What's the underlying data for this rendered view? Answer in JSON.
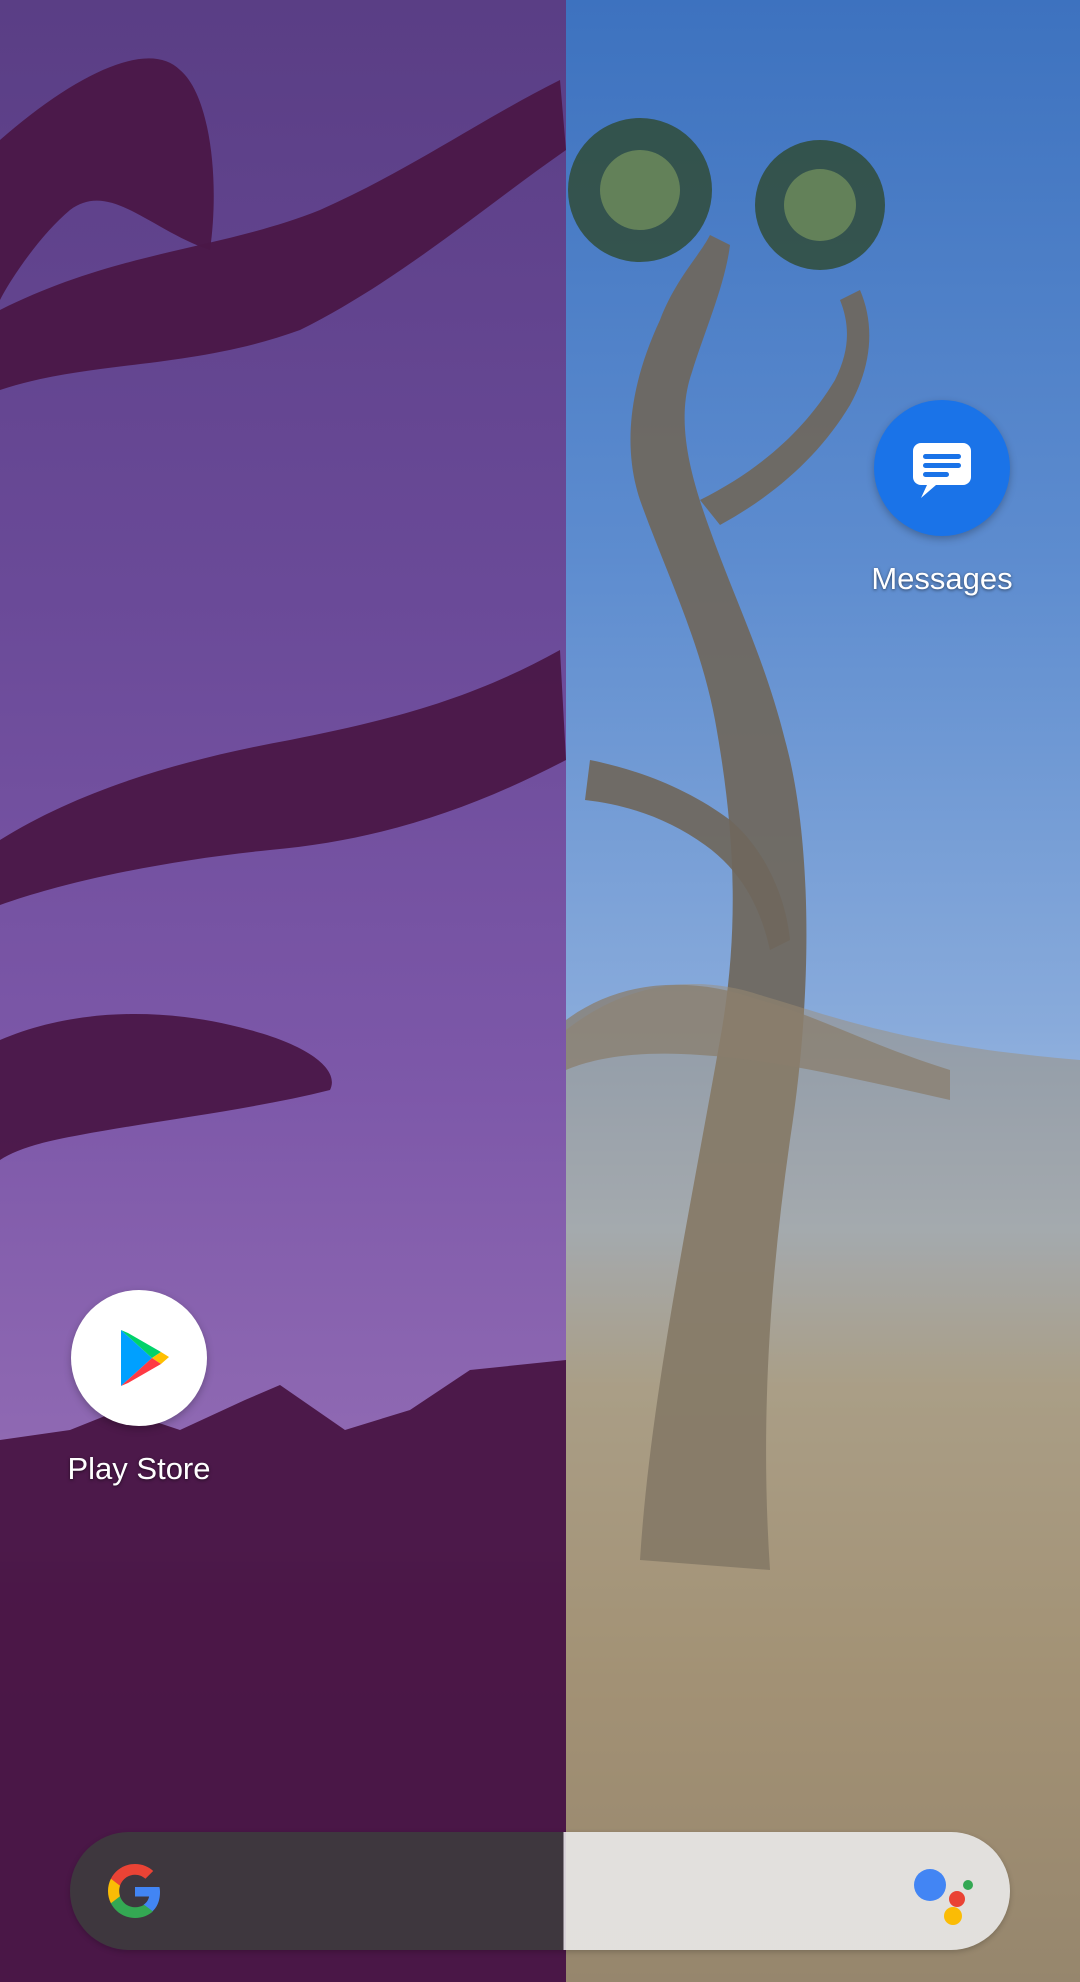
{
  "wallpaper": {
    "description": "",
    "accent_colors": {
      "left_sky": "#6a4a98",
      "left_silhouette": "#4a1747",
      "right_sky": "#5d8ccf",
      "right_ground": "#a79678"
    }
  },
  "apps": [
    {
      "id": "messages",
      "label": "Messages",
      "icon": "messages-icon",
      "icon_bg": "#1a73e8"
    },
    {
      "id": "playstore",
      "label": "Play Store",
      "icon": "play-store-icon",
      "icon_bg": "#ffffff"
    }
  ],
  "search_bar": {
    "left_icon": "google-logo-icon",
    "right_icon": "google-assistant-icon"
  }
}
